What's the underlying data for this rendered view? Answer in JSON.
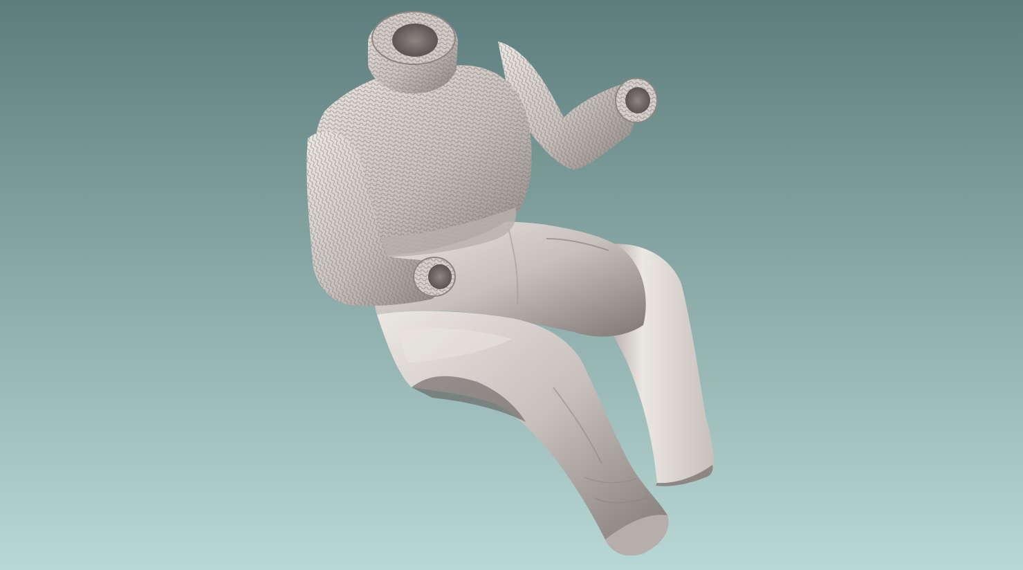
{
  "scene": {
    "background_top_color": "#5d7d7c",
    "background_bottom_color": "#b9d8d4",
    "model_color": "#c7c0bc",
    "model_shadow_color": "#6f6865",
    "model_highlight_color": "#ebe7e3"
  }
}
